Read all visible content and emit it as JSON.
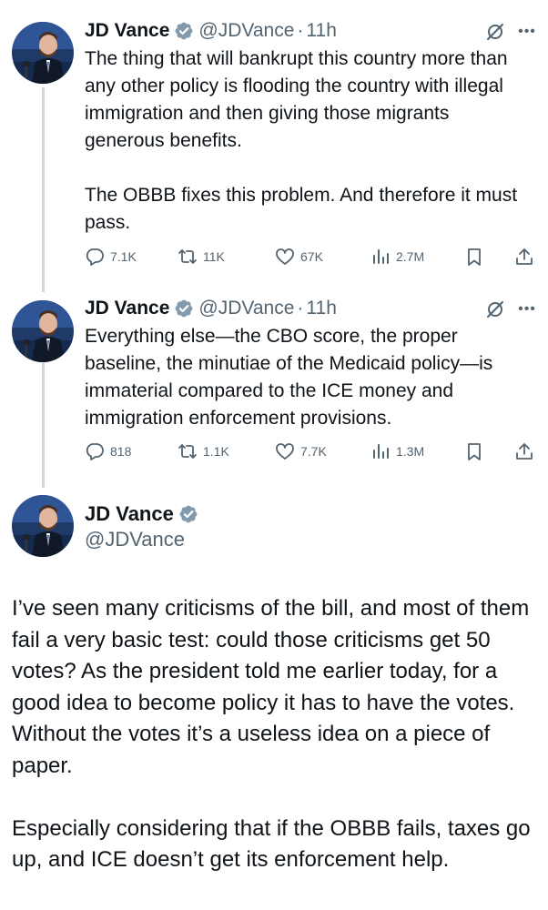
{
  "colors": {
    "text_primary": "#0f1419",
    "text_secondary": "#536471",
    "verified": "#829aab",
    "thread_line": "#cfd9de"
  },
  "thread": [
    {
      "name": "JD Vance",
      "handle": "@JDVance",
      "dot": "·",
      "time": "11h",
      "paragraphs": [
        "The thing that will bankrupt this country more than any other policy is flooding the country with illegal immigration and then giving those migrants generous benefits.",
        "The OBBB fixes this problem. And therefore it must pass."
      ],
      "stats": {
        "replies": "7.1K",
        "reposts": "11K",
        "likes": "67K",
        "views": "2.7M"
      }
    },
    {
      "name": "JD Vance",
      "handle": "@JDVance",
      "dot": "·",
      "time": "11h",
      "paragraphs": [
        "Everything else—the CBO score, the proper baseline, the minutiae of the Medicaid policy—is immaterial compared to the ICE money and immigration enforcement provisions."
      ],
      "stats": {
        "replies": "818",
        "reposts": "1.1K",
        "likes": "7.7K",
        "views": "1.3M"
      }
    }
  ],
  "main": {
    "name": "JD Vance",
    "handle": "@JDVance",
    "paragraphs": [
      "I’ve seen many criticisms of the bill, and most of them fail a very basic test: could those criticisms get 50 votes? As the president told me earlier today, for a good idea to become policy it has to have the votes. Without the votes it’s a useless idea on a piece of paper.",
      "Especially considering that if the OBBB fails, taxes go up, and ICE doesn’t get its enforcement help."
    ]
  },
  "icons": [
    "avatar-photo",
    "verified-badge-icon",
    "grok-icon",
    "more-icon",
    "reply-icon",
    "repost-icon",
    "like-icon",
    "views-icon",
    "bookmark-icon",
    "share-icon"
  ]
}
